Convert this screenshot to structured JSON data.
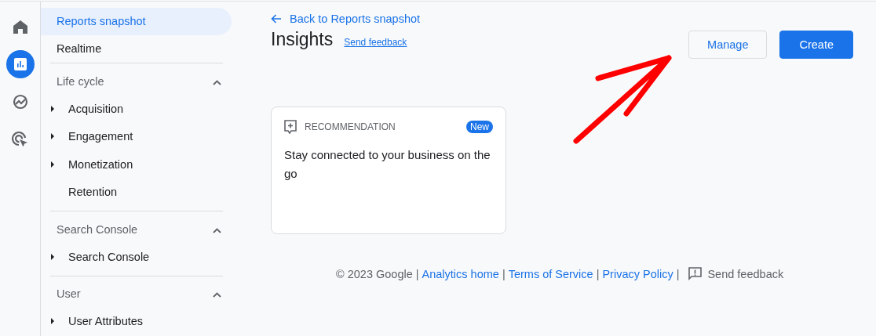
{
  "rail": [
    {
      "kind": "home",
      "selected": false
    },
    {
      "kind": "reports",
      "selected": true
    },
    {
      "kind": "explore",
      "selected": false
    },
    {
      "kind": "advertising",
      "selected": false
    }
  ],
  "sidebar": {
    "items": [
      {
        "label": "Reports snapshot",
        "selected": true
      },
      {
        "label": "Realtime",
        "selected": false
      }
    ],
    "sections": [
      {
        "title": "Life cycle",
        "expanded": true,
        "items": [
          {
            "label": "Acquisition",
            "expandable": true
          },
          {
            "label": "Engagement",
            "expandable": true
          },
          {
            "label": "Monetization",
            "expandable": true
          },
          {
            "label": "Retention",
            "expandable": false
          }
        ]
      },
      {
        "title": "Search Console",
        "expanded": true,
        "items": [
          {
            "label": "Search Console",
            "expandable": true
          }
        ]
      },
      {
        "title": "User",
        "expanded": true,
        "items": [
          {
            "label": "User Attributes",
            "expandable": true
          }
        ]
      }
    ]
  },
  "header": {
    "back_link": "Back to Reports snapshot",
    "title": "Insights",
    "feedback_link": "Send feedback",
    "buttons": [
      {
        "label": "Manage",
        "kind": "outlined"
      },
      {
        "label": "Create",
        "kind": "filled"
      }
    ]
  },
  "cards": [
    {
      "category": "RECOMMENDATION",
      "badge": "New",
      "text": "Stay connected to your business on the go"
    }
  ],
  "footer": {
    "items": [
      {
        "kind": "text",
        "text": "© 2023 Google"
      },
      {
        "kind": "separator",
        "text": "|"
      },
      {
        "kind": "link",
        "text": "Analytics home"
      },
      {
        "kind": "separator",
        "text": "|"
      },
      {
        "kind": "link",
        "text": "Terms of Service"
      },
      {
        "kind": "separator",
        "text": "|"
      },
      {
        "kind": "link",
        "text": "Privacy Policy"
      },
      {
        "kind": "separator",
        "text": "|"
      },
      {
        "kind": "feedback",
        "text": "Send feedback"
      }
    ]
  },
  "annotation": {
    "kind": "arrow"
  }
}
